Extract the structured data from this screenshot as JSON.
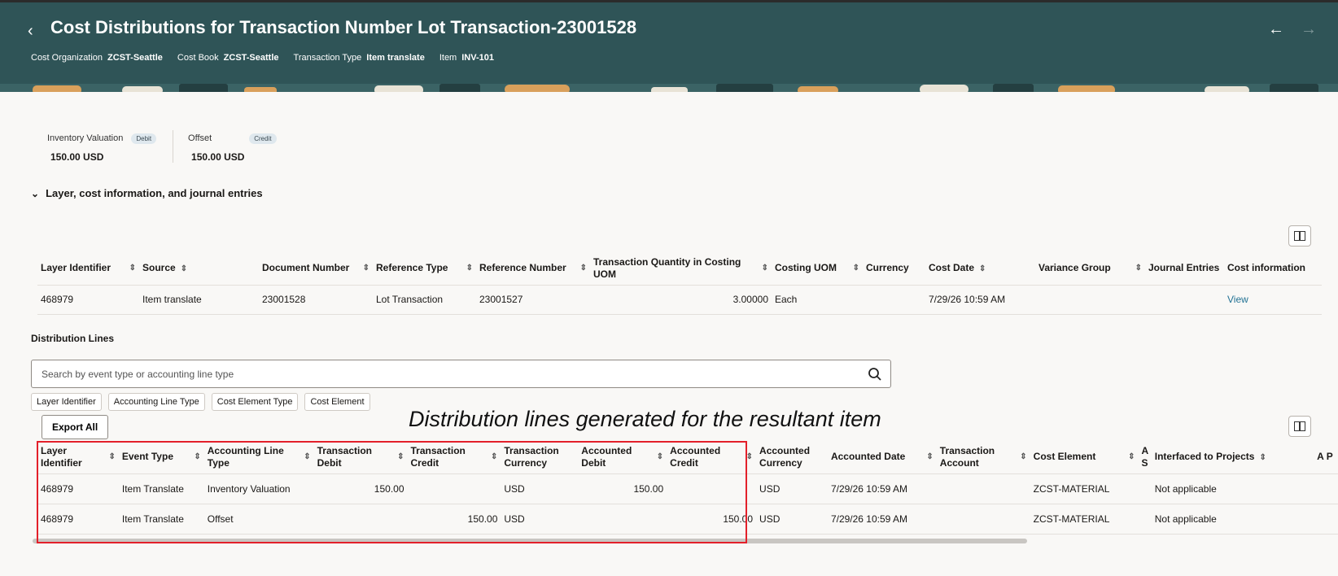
{
  "header": {
    "title": "Cost Distributions for Transaction Number Lot Transaction-23001528",
    "meta": [
      {
        "label": "Cost Organization",
        "value": "ZCST-Seattle"
      },
      {
        "label": "Cost Book",
        "value": "ZCST-Seattle"
      },
      {
        "label": "Transaction Type",
        "value": "Item translate"
      },
      {
        "label": "Item",
        "value": "INV-101"
      }
    ],
    "colors": {
      "background": "#2f5457"
    }
  },
  "summary": {
    "inventory": {
      "label": "Inventory Valuation",
      "badge": "Debit",
      "value": "150.00 USD"
    },
    "offset": {
      "label": "Offset",
      "badge": "Credit",
      "value": "150.00 USD"
    }
  },
  "section": {
    "label": "Layer, cost information, and journal entries"
  },
  "layer_table": {
    "headers": [
      "Layer Identifier",
      "Source",
      "Document Number",
      "Reference Type",
      "Reference Number",
      "Transaction Quantity in Costing UOM",
      "Costing UOM",
      "Currency",
      "Cost Date",
      "Variance Group",
      "Journal Entries",
      "Cost information"
    ],
    "row": {
      "layer_identifier": "468979",
      "source": "Item translate",
      "document_number": "23001528",
      "reference_type": "Lot Transaction",
      "reference_number": "23001527",
      "quantity": "3.00000",
      "costing_uom": "Each",
      "currency": "",
      "cost_date": "7/29/26 10:59 AM",
      "variance_group": "",
      "journal_entries": "",
      "cost_information": "View"
    }
  },
  "distribution": {
    "title": "Distribution Lines",
    "search_placeholder": "Search by event type or accounting line type",
    "filters": [
      "Layer Identifier",
      "Accounting Line Type",
      "Cost Element Type",
      "Cost Element"
    ],
    "export_label": "Export All",
    "annotation": "Distribution lines generated for the resultant item",
    "headers": [
      "Layer Identifier",
      "Event Type",
      "Accounting Line Type",
      "Transaction Debit",
      "Transaction Credit",
      "Transaction Currency",
      "Accounted Debit",
      "Accounted Credit",
      "Accounted Currency",
      "Accounted Date",
      "Transaction Account",
      "Cost Element",
      "A S",
      "Interfaced to Projects",
      "A P"
    ],
    "rows": [
      {
        "layer": "468979",
        "event": "Item Translate",
        "line_type": "Inventory Valuation",
        "tx_debit": "150.00",
        "tx_credit": "",
        "tx_currency": "USD",
        "acc_debit": "150.00",
        "acc_credit": "",
        "acc_currency": "USD",
        "acc_date": "7/29/26 10:59 AM",
        "tx_account": "",
        "cost_element": "ZCST-MATERIAL",
        "interfaced": "Not applicable"
      },
      {
        "layer": "468979",
        "event": "Item Translate",
        "line_type": "Offset",
        "tx_debit": "",
        "tx_credit": "150.00",
        "tx_currency": "USD",
        "acc_debit": "",
        "acc_credit": "150.00",
        "acc_currency": "USD",
        "acc_date": "7/29/26 10:59 AM",
        "tx_account": "",
        "cost_element": "ZCST-MATERIAL",
        "interfaced": "Not applicable"
      }
    ],
    "highlight_color": "#e3202a"
  }
}
